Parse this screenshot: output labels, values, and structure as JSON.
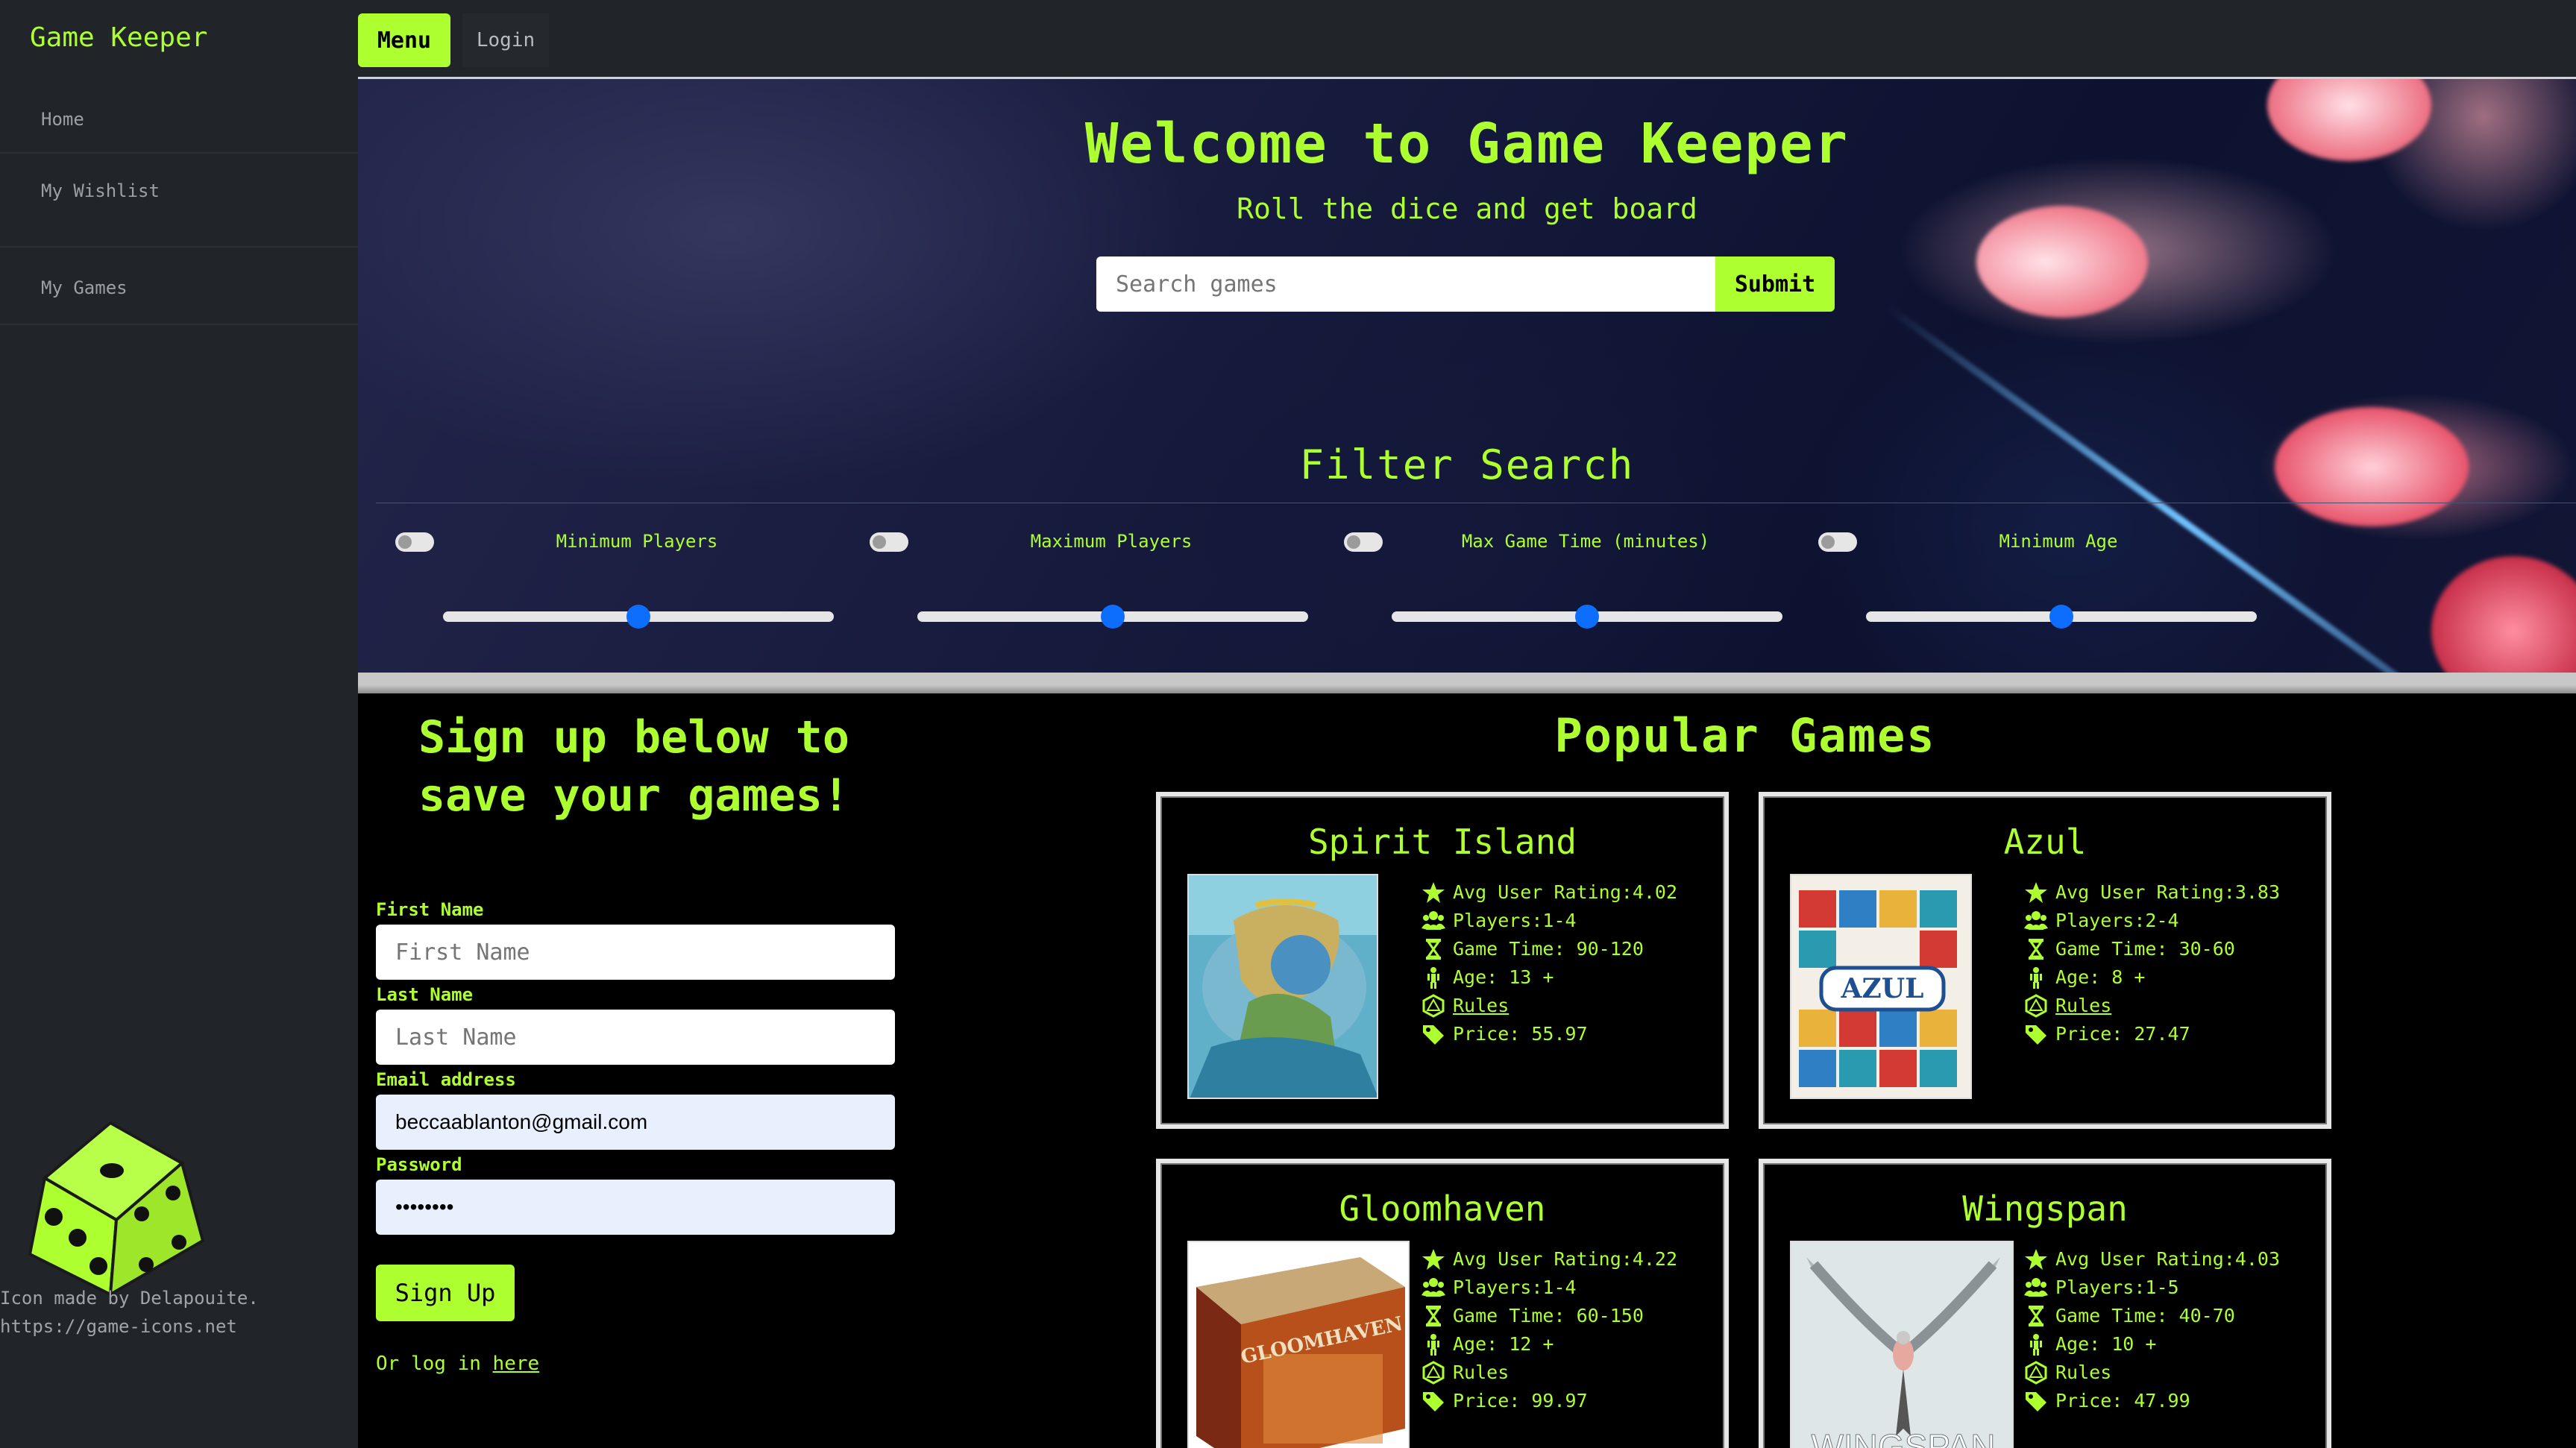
{
  "sidebar": {
    "brand": "Game Keeper",
    "items": [
      {
        "label": "Home"
      },
      {
        "label": "My Wishlist"
      },
      {
        "label": "My Games"
      }
    ],
    "credit_line1": "Icon made by Delapouite.",
    "credit_line2": "https://game-icons.net"
  },
  "topbar": {
    "menu_label": "Menu",
    "login_label": "Login"
  },
  "hero": {
    "title": "Welcome to Game Keeper",
    "subtitle": "Roll the dice and get board",
    "search_placeholder": "Search games",
    "submit_label": "Submit",
    "filter_title": "Filter Search",
    "filters": [
      {
        "label": "Minimum Players",
        "value_fraction": 0.5
      },
      {
        "label": "Maximum Players",
        "value_fraction": 0.5
      },
      {
        "label": "Max Game Time (minutes)",
        "value_fraction": 0.5
      },
      {
        "label": "Minimum Age",
        "value_fraction": 0.5
      }
    ]
  },
  "signup": {
    "title_line1": "Sign up below to",
    "title_line2": "save your games!",
    "first_name_label": "First Name",
    "first_name_placeholder": "First Name",
    "last_name_label": "Last Name",
    "last_name_placeholder": "Last Name",
    "email_label": "Email address",
    "email_value": "beccaablanton@gmail.com",
    "password_label": "Password",
    "password_value": "••••••••",
    "submit_label": "Sign Up",
    "login_prefix": "Or log in",
    "login_link": "here"
  },
  "popular": {
    "title": "Popular Games",
    "games": [
      {
        "name": "Spirit Island",
        "rating": "Avg User Rating:4.02",
        "players": "Players:1-4",
        "time": "Game Time: 90-120",
        "age": "Age: 13 +",
        "rules": "Rules",
        "price": "Price: 55.97"
      },
      {
        "name": "Azul",
        "rating": "Avg User Rating:3.83",
        "players": "Players:2-4",
        "time": "Game Time: 30-60",
        "age": "Age: 8 +",
        "rules": "Rules",
        "price": "Price: 27.47"
      },
      {
        "name": "Gloomhaven",
        "rating": "Avg User Rating:4.22",
        "players": "Players:1-4",
        "time": "Game Time: 60-150",
        "age": "Age: 12 +",
        "rules": "Rules",
        "price": "Price: 99.97"
      },
      {
        "name": "Wingspan",
        "rating": "Avg User Rating:4.03",
        "players": "Players:1-5",
        "time": "Game Time: 40-70",
        "age": "Age: 10 +",
        "rules": "Rules",
        "price": "Price: 47.99"
      }
    ],
    "box_art_text": {
      "azul": "AZUL",
      "gloomhaven": "GLOOMHAVEN",
      "wingspan": "WINGSPAN"
    }
  },
  "colors": {
    "accent": "#adff2f",
    "sidebar_bg": "#212529",
    "slider_thumb": "#0d6efd"
  }
}
